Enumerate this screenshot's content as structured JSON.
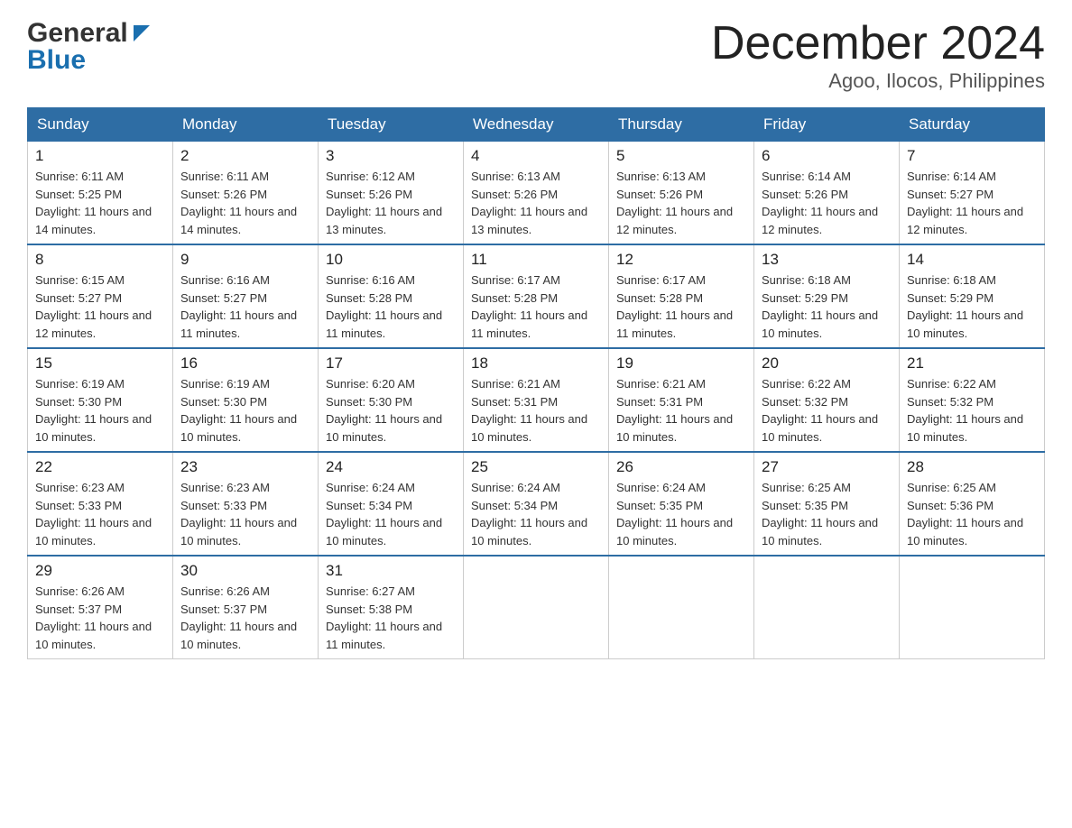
{
  "header": {
    "logo_general": "General",
    "logo_blue": "Blue",
    "month_title": "December 2024",
    "location": "Agoo, Ilocos, Philippines"
  },
  "days_of_week": [
    "Sunday",
    "Monday",
    "Tuesday",
    "Wednesday",
    "Thursday",
    "Friday",
    "Saturday"
  ],
  "weeks": [
    [
      {
        "day": "1",
        "sunrise": "6:11 AM",
        "sunset": "5:25 PM",
        "daylight": "11 hours and 14 minutes."
      },
      {
        "day": "2",
        "sunrise": "6:11 AM",
        "sunset": "5:26 PM",
        "daylight": "11 hours and 14 minutes."
      },
      {
        "day": "3",
        "sunrise": "6:12 AM",
        "sunset": "5:26 PM",
        "daylight": "11 hours and 13 minutes."
      },
      {
        "day": "4",
        "sunrise": "6:13 AM",
        "sunset": "5:26 PM",
        "daylight": "11 hours and 13 minutes."
      },
      {
        "day": "5",
        "sunrise": "6:13 AM",
        "sunset": "5:26 PM",
        "daylight": "11 hours and 12 minutes."
      },
      {
        "day": "6",
        "sunrise": "6:14 AM",
        "sunset": "5:26 PM",
        "daylight": "11 hours and 12 minutes."
      },
      {
        "day": "7",
        "sunrise": "6:14 AM",
        "sunset": "5:27 PM",
        "daylight": "11 hours and 12 minutes."
      }
    ],
    [
      {
        "day": "8",
        "sunrise": "6:15 AM",
        "sunset": "5:27 PM",
        "daylight": "11 hours and 12 minutes."
      },
      {
        "day": "9",
        "sunrise": "6:16 AM",
        "sunset": "5:27 PM",
        "daylight": "11 hours and 11 minutes."
      },
      {
        "day": "10",
        "sunrise": "6:16 AM",
        "sunset": "5:28 PM",
        "daylight": "11 hours and 11 minutes."
      },
      {
        "day": "11",
        "sunrise": "6:17 AM",
        "sunset": "5:28 PM",
        "daylight": "11 hours and 11 minutes."
      },
      {
        "day": "12",
        "sunrise": "6:17 AM",
        "sunset": "5:28 PM",
        "daylight": "11 hours and 11 minutes."
      },
      {
        "day": "13",
        "sunrise": "6:18 AM",
        "sunset": "5:29 PM",
        "daylight": "11 hours and 10 minutes."
      },
      {
        "day": "14",
        "sunrise": "6:18 AM",
        "sunset": "5:29 PM",
        "daylight": "11 hours and 10 minutes."
      }
    ],
    [
      {
        "day": "15",
        "sunrise": "6:19 AM",
        "sunset": "5:30 PM",
        "daylight": "11 hours and 10 minutes."
      },
      {
        "day": "16",
        "sunrise": "6:19 AM",
        "sunset": "5:30 PM",
        "daylight": "11 hours and 10 minutes."
      },
      {
        "day": "17",
        "sunrise": "6:20 AM",
        "sunset": "5:30 PM",
        "daylight": "11 hours and 10 minutes."
      },
      {
        "day": "18",
        "sunrise": "6:21 AM",
        "sunset": "5:31 PM",
        "daylight": "11 hours and 10 minutes."
      },
      {
        "day": "19",
        "sunrise": "6:21 AM",
        "sunset": "5:31 PM",
        "daylight": "11 hours and 10 minutes."
      },
      {
        "day": "20",
        "sunrise": "6:22 AM",
        "sunset": "5:32 PM",
        "daylight": "11 hours and 10 minutes."
      },
      {
        "day": "21",
        "sunrise": "6:22 AM",
        "sunset": "5:32 PM",
        "daylight": "11 hours and 10 minutes."
      }
    ],
    [
      {
        "day": "22",
        "sunrise": "6:23 AM",
        "sunset": "5:33 PM",
        "daylight": "11 hours and 10 minutes."
      },
      {
        "day": "23",
        "sunrise": "6:23 AM",
        "sunset": "5:33 PM",
        "daylight": "11 hours and 10 minutes."
      },
      {
        "day": "24",
        "sunrise": "6:24 AM",
        "sunset": "5:34 PM",
        "daylight": "11 hours and 10 minutes."
      },
      {
        "day": "25",
        "sunrise": "6:24 AM",
        "sunset": "5:34 PM",
        "daylight": "11 hours and 10 minutes."
      },
      {
        "day": "26",
        "sunrise": "6:24 AM",
        "sunset": "5:35 PM",
        "daylight": "11 hours and 10 minutes."
      },
      {
        "day": "27",
        "sunrise": "6:25 AM",
        "sunset": "5:35 PM",
        "daylight": "11 hours and 10 minutes."
      },
      {
        "day": "28",
        "sunrise": "6:25 AM",
        "sunset": "5:36 PM",
        "daylight": "11 hours and 10 minutes."
      }
    ],
    [
      {
        "day": "29",
        "sunrise": "6:26 AM",
        "sunset": "5:37 PM",
        "daylight": "11 hours and 10 minutes."
      },
      {
        "day": "30",
        "sunrise": "6:26 AM",
        "sunset": "5:37 PM",
        "daylight": "11 hours and 10 minutes."
      },
      {
        "day": "31",
        "sunrise": "6:27 AM",
        "sunset": "5:38 PM",
        "daylight": "11 hours and 11 minutes."
      },
      null,
      null,
      null,
      null
    ]
  ],
  "labels": {
    "sunrise": "Sunrise:",
    "sunset": "Sunset:",
    "daylight": "Daylight:"
  }
}
